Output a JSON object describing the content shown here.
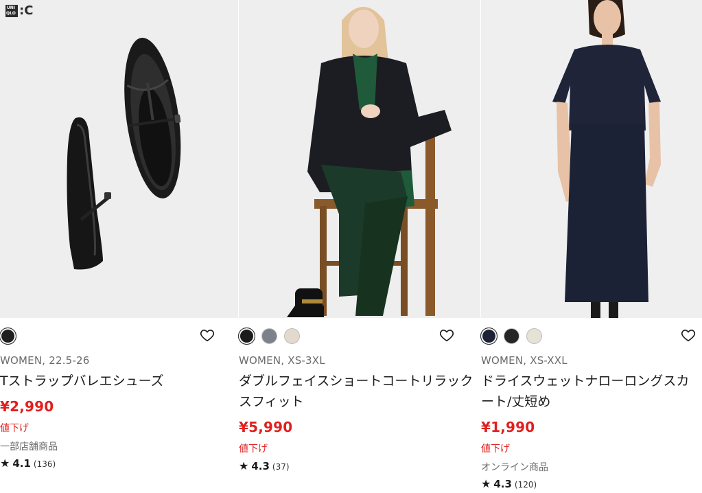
{
  "colors": {
    "price_red": "#e01f1f",
    "muted_text": "#6b6b6b",
    "image_background": "#eeeeee"
  },
  "logo": {
    "box_letters": [
      "UNI",
      "QLO"
    ],
    "suffix": ":C"
  },
  "products": [
    {
      "swatches": [
        {
          "color": "#1f1f1f",
          "selected": true
        }
      ],
      "meta": "WOMEN, 22.5-26",
      "name": "Tストラップバレエシューズ",
      "price": "¥2,990",
      "sale_label": "値下げ",
      "store_label": "一部店舗商品",
      "rating": {
        "star": "★",
        "score": "4.1",
        "count": "(136)"
      },
      "favorite_icon": "heart-outline-icon"
    },
    {
      "swatches": [
        {
          "color": "#1c1c1e",
          "selected": true
        },
        {
          "color": "#7d818b",
          "selected": false
        },
        {
          "color": "#e4d9cd",
          "selected": false
        }
      ],
      "meta": "WOMEN, XS-3XL",
      "name": "ダブルフェイスショートコートリラックスフィット",
      "price": "¥5,990",
      "sale_label": "値下げ",
      "store_label": "",
      "rating": {
        "star": "★",
        "score": "4.3",
        "count": "(37)"
      },
      "favorite_icon": "heart-outline-icon"
    },
    {
      "swatches": [
        {
          "color": "#1d2238",
          "selected": true
        },
        {
          "color": "#262626",
          "selected": false
        },
        {
          "color": "#e6e2d6",
          "selected": false
        }
      ],
      "meta": "WOMEN, XS-XXL",
      "name": "ドライスウェットナローロングスカート/丈短め",
      "price": "¥1,990",
      "sale_label": "値下げ",
      "store_label": "オンライン商品",
      "rating": {
        "star": "★",
        "score": "4.3",
        "count": "(120)"
      },
      "favorite_icon": "heart-outline-icon"
    }
  ]
}
